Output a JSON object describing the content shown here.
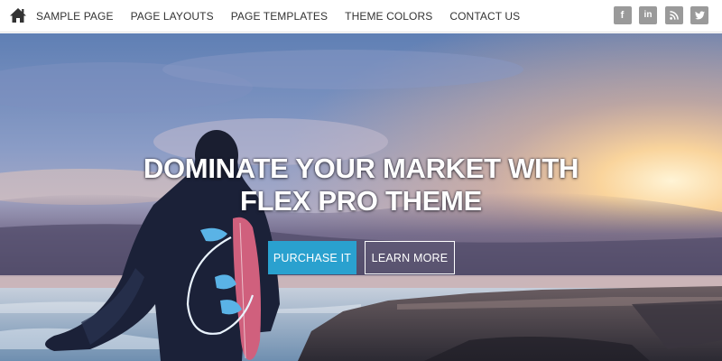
{
  "header": {
    "nav": [
      {
        "label": "SAMPLE PAGE"
      },
      {
        "label": "PAGE LAYOUTS"
      },
      {
        "label": "PAGE TEMPLATES"
      },
      {
        "label": "THEME COLORS"
      },
      {
        "label": "CONTACT US"
      }
    ],
    "social": [
      {
        "icon": "facebook-icon",
        "glyph": "f"
      },
      {
        "icon": "linkedin-icon",
        "glyph": "in"
      },
      {
        "icon": "rss-icon",
        "glyph": ""
      },
      {
        "icon": "twitter-icon",
        "glyph": ""
      }
    ],
    "home_icon": "home-icon"
  },
  "hero": {
    "headline_line1": "DOMINATE YOUR MARKET WITH",
    "headline_line2": "FLEX PRO THEME",
    "primary_button": "PURCHASE IT",
    "secondary_button": "LEARN MORE",
    "background": "photo of a surfer holding a surfboard on a rocky shore at sunset"
  },
  "colors": {
    "accent": "#2aa1cf",
    "nav_text": "#333333",
    "social_bg": "#9a9a9a"
  }
}
